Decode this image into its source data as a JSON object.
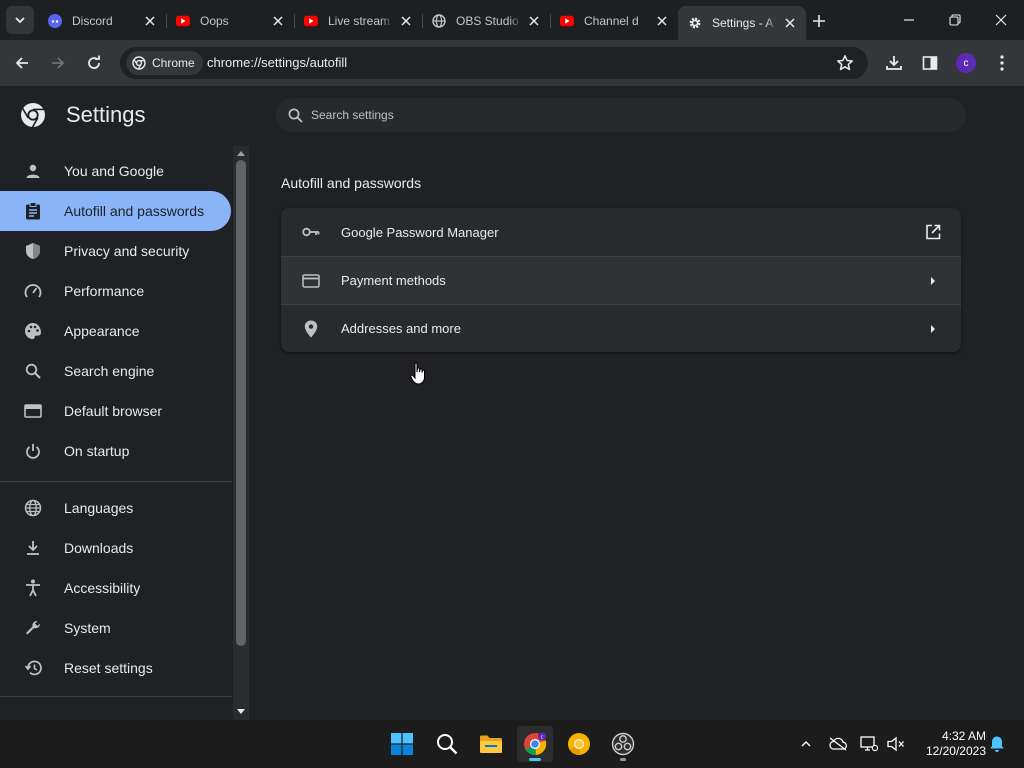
{
  "browser": {
    "tabs": [
      {
        "title": "Discord",
        "icon": "discord-icon",
        "active": false
      },
      {
        "title": "Oops",
        "icon": "youtube-icon",
        "active": false
      },
      {
        "title": "Live stream",
        "icon": "youtube-icon",
        "active": false
      },
      {
        "title": "OBS Studio",
        "icon": "globe-icon",
        "active": false
      },
      {
        "title": "Channel d",
        "icon": "youtube-icon",
        "active": false
      },
      {
        "title": "Settings - A",
        "icon": "gear-icon",
        "active": true
      }
    ],
    "omnibox": {
      "chip_label": "Chrome",
      "url": "chrome://settings/autofill"
    },
    "profile_initial": "c"
  },
  "settings": {
    "title": "Settings",
    "search_placeholder": "Search settings",
    "nav": [
      {
        "label": "You and Google",
        "icon": "person-icon",
        "active": false
      },
      {
        "label": "Autofill and passwords",
        "icon": "clipboard-icon",
        "active": true
      },
      {
        "label": "Privacy and security",
        "icon": "shield-icon",
        "active": false
      },
      {
        "label": "Performance",
        "icon": "speedometer-icon",
        "active": false
      },
      {
        "label": "Appearance",
        "icon": "palette-icon",
        "active": false
      },
      {
        "label": "Search engine",
        "icon": "search-icon",
        "active": false
      },
      {
        "label": "Default browser",
        "icon": "browser-window-icon",
        "active": false
      },
      {
        "label": "On startup",
        "icon": "power-icon",
        "active": false
      },
      {
        "label": "Languages",
        "icon": "globe-icon",
        "active": false
      },
      {
        "label": "Downloads",
        "icon": "download-icon",
        "active": false
      },
      {
        "label": "Accessibility",
        "icon": "accessibility-icon",
        "active": false
      },
      {
        "label": "System",
        "icon": "wrench-icon",
        "active": false
      },
      {
        "label": "Reset settings",
        "icon": "history-icon",
        "active": false
      }
    ],
    "section_title": "Autofill and passwords",
    "rows": [
      {
        "label": "Google Password Manager",
        "icon": "key-icon",
        "trailing": "open-external-icon"
      },
      {
        "label": "Payment methods",
        "icon": "credit-card-icon",
        "trailing": "chevron-right-icon"
      },
      {
        "label": "Addresses and more",
        "icon": "location-pin-icon",
        "trailing": "chevron-right-icon"
      }
    ],
    "accent_color": "#8ab4f8"
  },
  "taskbar": {
    "apps": [
      "windows-start-icon",
      "search-icon",
      "file-explorer-icon",
      "chrome-icon",
      "chrome-canary-icon",
      "obs-icon"
    ],
    "time": "4:32 AM",
    "date": "12/20/2023"
  }
}
